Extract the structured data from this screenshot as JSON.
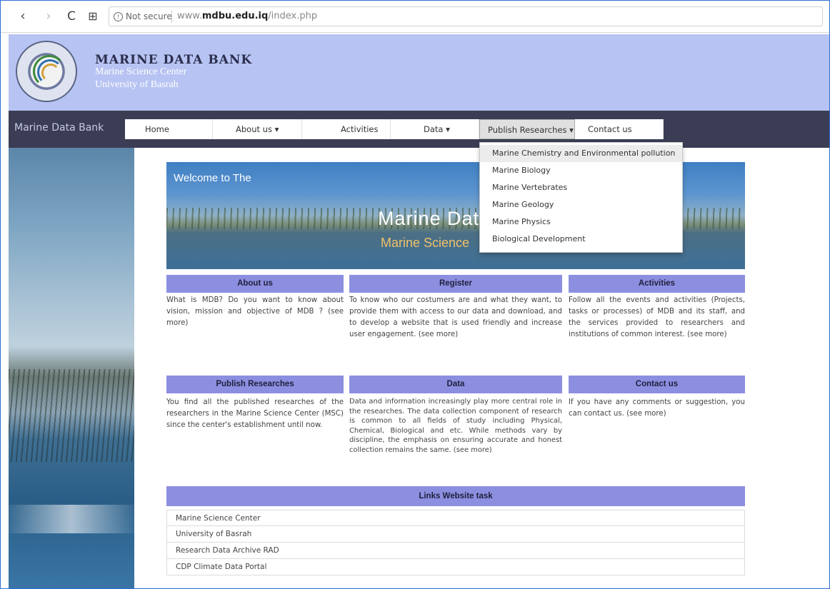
{
  "browser": {
    "back": "‹",
    "forward": "›",
    "reload": "C",
    "tabs_icon": "⊞",
    "security": "Not secure",
    "url_prefix": "www.",
    "url_domain": "mdbu.edu.iq",
    "url_path": "/index.php"
  },
  "header": {
    "title": "MARINE DATA BANK",
    "subtitle1": "Marine Science Center",
    "subtitle2": "University of Basrah"
  },
  "nav": {
    "brand": "Marine Data Bank",
    "items": [
      {
        "label": "Home"
      },
      {
        "label": "About us ▾"
      },
      {
        "label": "Activities"
      },
      {
        "label": "Data ▾"
      },
      {
        "label": "Publish Researches ▾"
      },
      {
        "label": "Contact us"
      }
    ]
  },
  "dropdown": {
    "items": [
      "Marine Chemistry and Environmental pollution",
      "Marine Biology",
      "Marine Vertebrates",
      "Marine Geology",
      "Marine Physics",
      "Biological Development"
    ]
  },
  "banner": {
    "welcome": "Welcome to The",
    "title": "Marine  Data",
    "subtitle": "Marine Science"
  },
  "sections": [
    {
      "title": "About us",
      "text": "What is MDB? Do you want to know about vision, mission and objective of MDB ? (see more)"
    },
    {
      "title": "Register",
      "text": "To know who our costumers are and what they want, to provide them with access to our data and download, and to develop a website that is used friendly and increase user engagement. (see more)"
    },
    {
      "title": "Activities",
      "text": "Follow all the events and activities (Projects, tasks or processes) of MDB and its staff, and the services provided to researchers and institutions of common interest. (see more)"
    },
    {
      "title": "Publish Researches",
      "text": "You find all the published researches of the researchers in the Marine Science Center (MSC) since the center's establishment until now."
    },
    {
      "title": "Data",
      "text": "Data and information increasingly play more central role in the researches. The data collection component of research is common to all fields of study including Physical, Chemical, Biological and etc. While methods vary by discipline, the emphasis on ensuring accurate and honest collection remains the same. (see more)"
    },
    {
      "title": "Contact us",
      "text": "If you have any comments or suggestion, you can contact us. (see more)"
    }
  ],
  "links": {
    "title": "Links Website task",
    "items": [
      "Marine Science Center",
      "University of Basrah",
      "Research Data Archive RAD",
      "CDP Climate Data Portal"
    ]
  },
  "colors": {
    "header_bg": "#b7c3f2",
    "nav_bg": "#3b3d55",
    "section_header": "#8c8fe0"
  }
}
